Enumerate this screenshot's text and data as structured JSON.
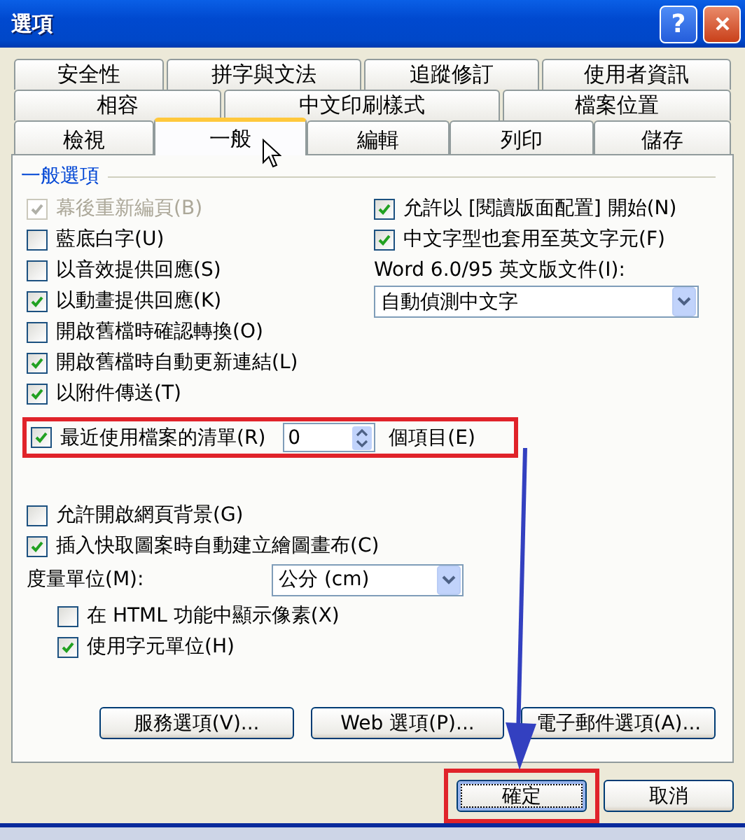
{
  "window": {
    "title": "選項",
    "help": "?"
  },
  "tab_rows": [
    [
      {
        "label": "安全性",
        "selected": false
      },
      {
        "label": "拼字與文法",
        "selected": false
      },
      {
        "label": "追蹤修訂",
        "selected": false
      },
      {
        "label": "使用者資訊",
        "selected": false
      }
    ],
    [
      {
        "label": "相容",
        "selected": false
      },
      {
        "label": "中文印刷樣式",
        "selected": false
      },
      {
        "label": "檔案位置",
        "selected": false
      }
    ],
    [
      {
        "label": "檢視",
        "selected": false
      },
      {
        "label": "一般",
        "selected": true
      },
      {
        "label": "編輯",
        "selected": false
      },
      {
        "label": "列印",
        "selected": false
      },
      {
        "label": "儲存",
        "selected": false
      }
    ]
  ],
  "group_label": "一般選項",
  "left_options": [
    {
      "label": "幕後重新編頁(B)",
      "checked": true,
      "disabled": true
    },
    {
      "label": "藍底白字(U)",
      "checked": false,
      "disabled": false
    },
    {
      "label": "以音效提供回應(S)",
      "checked": false,
      "disabled": false
    },
    {
      "label": "以動畫提供回應(K)",
      "checked": true,
      "disabled": false
    },
    {
      "label": "開啟舊檔時確認轉換(O)",
      "checked": false,
      "disabled": false
    },
    {
      "label": "開啟舊檔時自動更新連結(L)",
      "checked": true,
      "disabled": false
    },
    {
      "label": "以附件傳送(T)",
      "checked": true,
      "disabled": false
    }
  ],
  "right_options": [
    {
      "label": "允許以 [閱讀版面配置] 開始(N)",
      "checked": true
    },
    {
      "label": "中文字型也套用至英文字元(F)",
      "checked": true
    }
  ],
  "word_label": "Word 6.0/95 英文版文件(I):",
  "word_dropdown": {
    "value": "自動偵測中文字"
  },
  "recent": {
    "label": "最近使用檔案的清單(R)",
    "checked": true,
    "value": "0",
    "suffix": "個項目(E)"
  },
  "lower_options": [
    {
      "label": "允許開啟網頁背景(G)",
      "checked": false
    },
    {
      "label": "插入快取圖案時自動建立繪圖畫布(C)",
      "checked": true
    }
  ],
  "units_label": "度量單位(M):",
  "units_dropdown": {
    "value": "公分 (cm)"
  },
  "indented_options": [
    {
      "label": "在 HTML 功能中顯示像素(X)",
      "checked": false
    },
    {
      "label": "使用字元單位(H)",
      "checked": true
    }
  ],
  "panel_buttons": [
    "服務選項(V)...",
    "Web 選項(P)...",
    "電子郵件選項(A)..."
  ],
  "dialog_buttons": [
    {
      "label": "確定",
      "kind": "default"
    },
    {
      "label": "取消",
      "kind": "normal"
    }
  ]
}
